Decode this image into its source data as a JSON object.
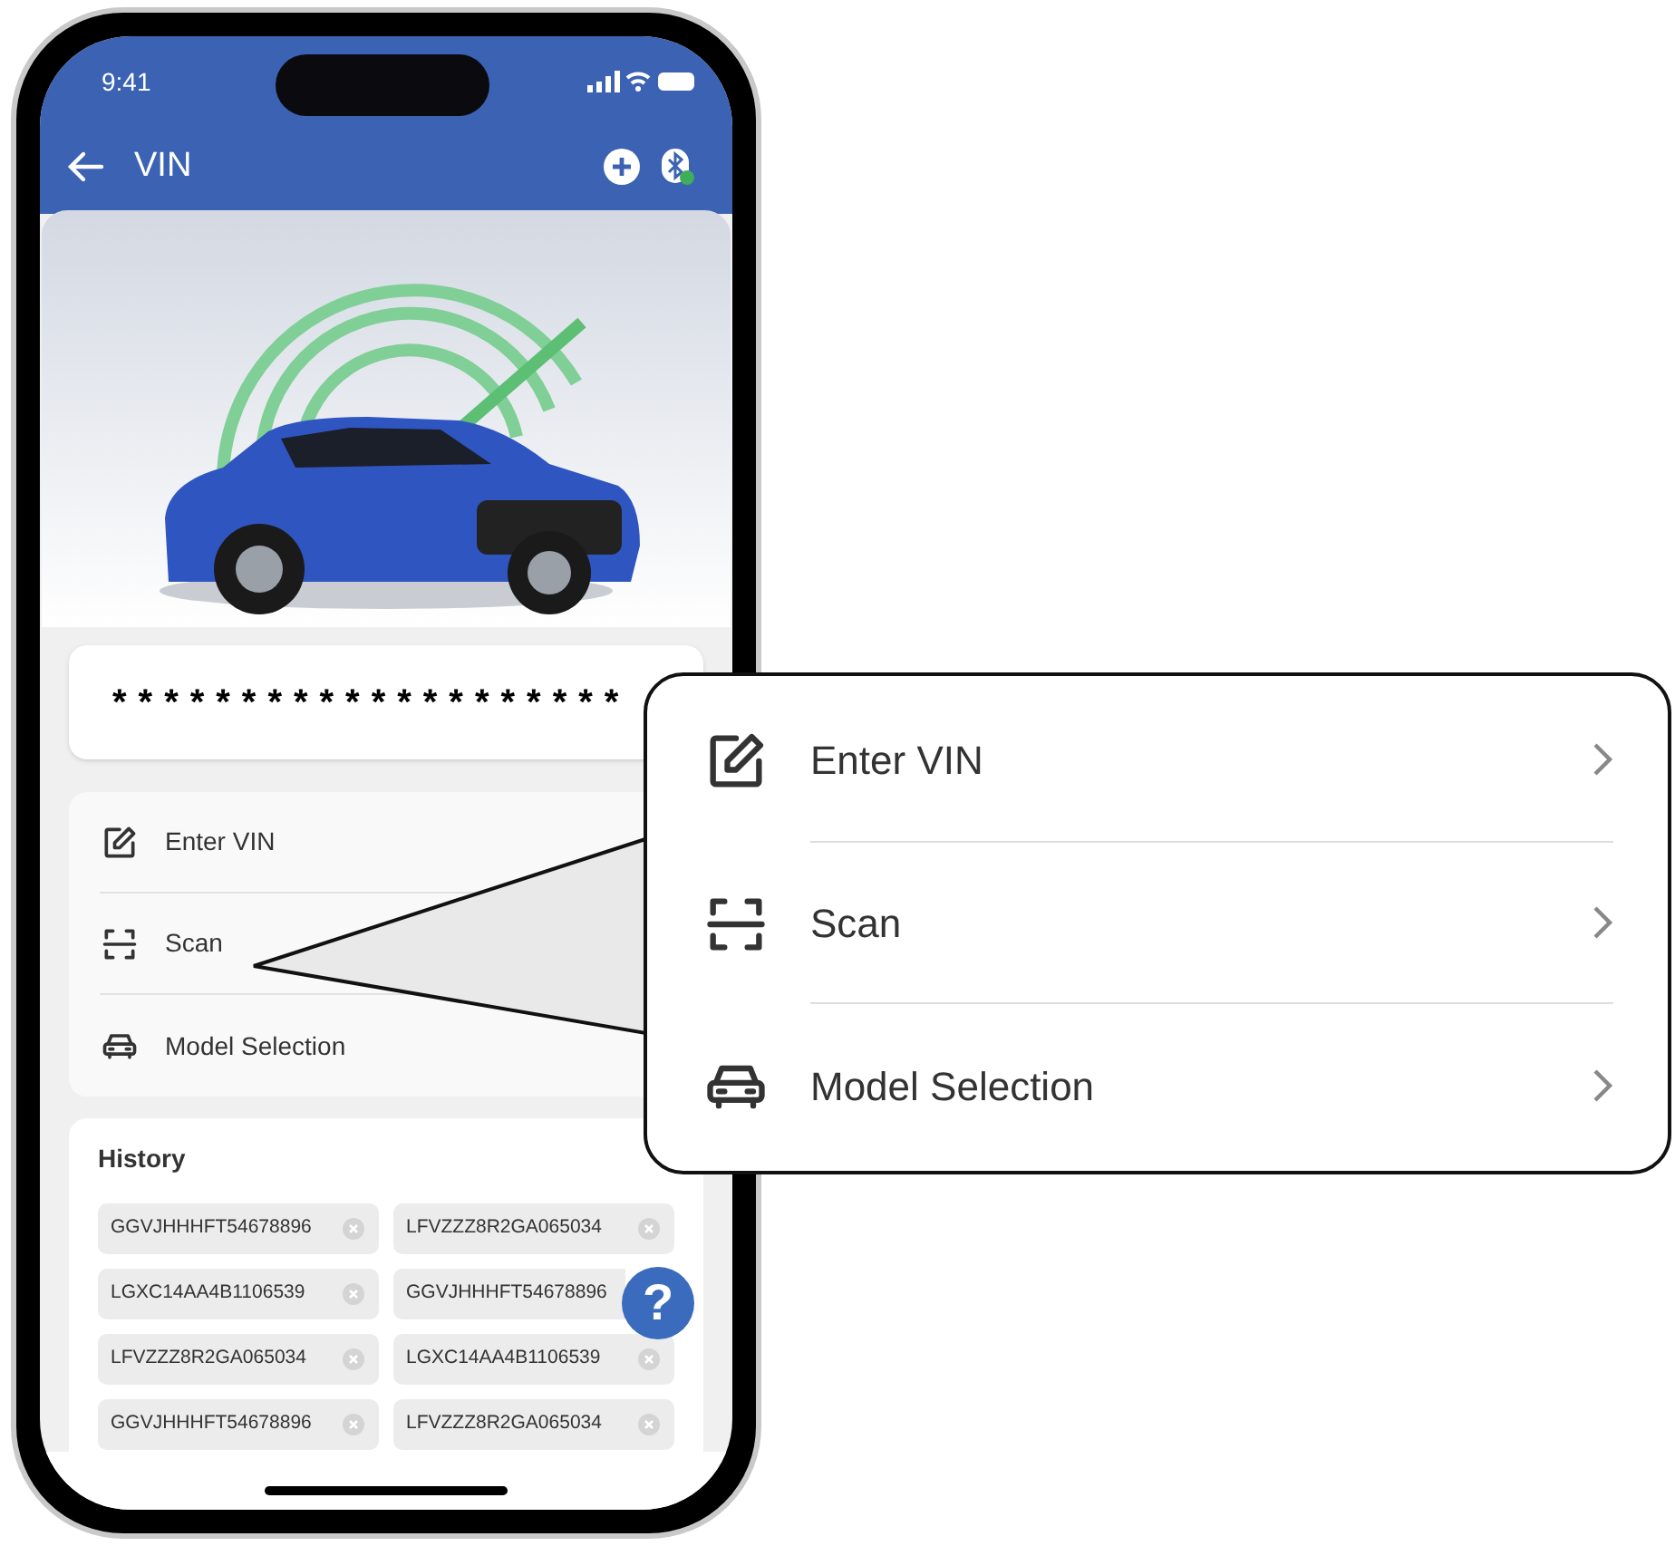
{
  "status_bar": {
    "time": "9:41"
  },
  "header": {
    "title": "VIN"
  },
  "vin_field": {
    "value": "********************"
  },
  "menu": [
    {
      "kind": "edit",
      "label": "Enter VIN"
    },
    {
      "kind": "scan",
      "label": "Scan"
    },
    {
      "kind": "car",
      "label": "Model Selection"
    }
  ],
  "history": {
    "title": "History",
    "chips": [
      "GGVJHHHFT54678896",
      "LFVZZZ8R2GA065034",
      "LGXC14AA4B1106539",
      "GGVJHHHFT54678896",
      "LFVZZZ8R2GA065034",
      "LGXC14AA4B1106539",
      "GGVJHHHFT54678896",
      "LFVZZZ8R2GA065034"
    ]
  },
  "help_button": {
    "label": "?"
  },
  "callout": [
    {
      "kind": "edit",
      "label": "Enter VIN"
    },
    {
      "kind": "scan",
      "label": "Scan"
    },
    {
      "kind": "car",
      "label": "Model Selection"
    }
  ]
}
